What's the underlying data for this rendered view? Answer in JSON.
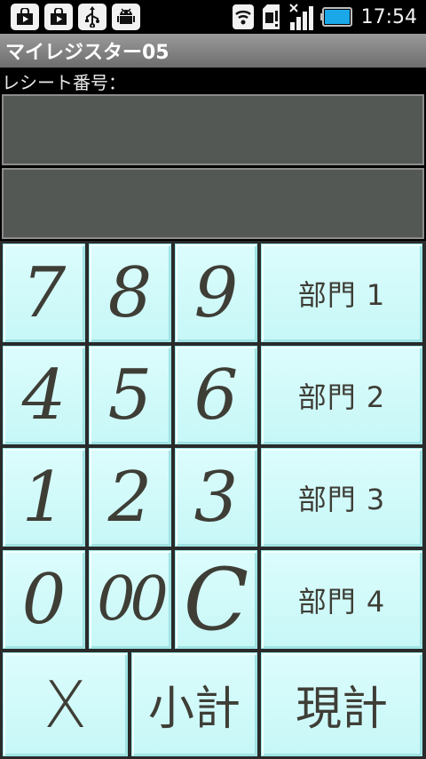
{
  "status_bar": {
    "time": "17:54",
    "left_icons": [
      "store-icon",
      "play-store-icon",
      "usb-icon",
      "android-debug-icon"
    ],
    "right_icons": [
      "wifi-icon",
      "sim-alert-icon",
      "signal-icon",
      "battery-icon"
    ]
  },
  "app": {
    "title": "マイレジスター05"
  },
  "receipt": {
    "label": "レシート番号：",
    "display_line_1": "",
    "display_line_2": ""
  },
  "keypad": {
    "rows": [
      [
        "7",
        "8",
        "9",
        "部門 1"
      ],
      [
        "4",
        "5",
        "6",
        "部門 2"
      ],
      [
        "1",
        "2",
        "3",
        "部門 3"
      ],
      [
        "0",
        "00",
        "C",
        "部門 4"
      ]
    ],
    "bottom": [
      "X",
      "小計",
      "現計"
    ]
  },
  "colors": {
    "key_background": "#d2fafa",
    "key_text": "#3e3e36",
    "display_background": "#545854",
    "title_bar": "#7f7f7f"
  }
}
